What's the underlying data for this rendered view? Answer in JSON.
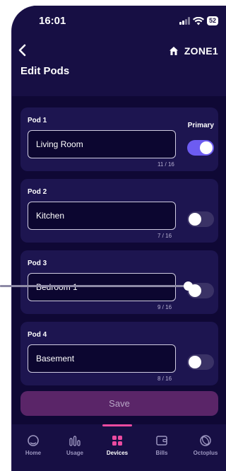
{
  "status": {
    "time": "16:01",
    "battery": "52"
  },
  "header": {
    "zone": "ZONE1",
    "title": "Edit Pods"
  },
  "pods": [
    {
      "label": "Pod 1",
      "name": "Living Room",
      "count": "11 / 16",
      "primary": true
    },
    {
      "label": "Pod 2",
      "name": "Kitchen",
      "count": "7 / 16",
      "primary": false
    },
    {
      "label": "Pod 3",
      "name": "Bedroom 1",
      "count": "9 / 16",
      "primary": false
    },
    {
      "label": "Pod 4",
      "name": "Basement",
      "count": "8 / 16",
      "primary": false
    }
  ],
  "primary_label": "Primary",
  "save_label": "Save",
  "nav": {
    "active": "Devices",
    "items": [
      {
        "label": "Home",
        "icon": "home-icon"
      },
      {
        "label": "Usage",
        "icon": "usage-icon"
      },
      {
        "label": "Devices",
        "icon": "devices-icon"
      },
      {
        "label": "Bills",
        "icon": "bills-icon"
      },
      {
        "label": "Octoplus",
        "icon": "octoplus-icon"
      }
    ]
  },
  "colors": {
    "background": "#0f0835",
    "card": "#1d1550",
    "toggle_on": "#6d5cf1",
    "save_button": "#5a2568",
    "nav_accent": "#ec4ba0"
  }
}
